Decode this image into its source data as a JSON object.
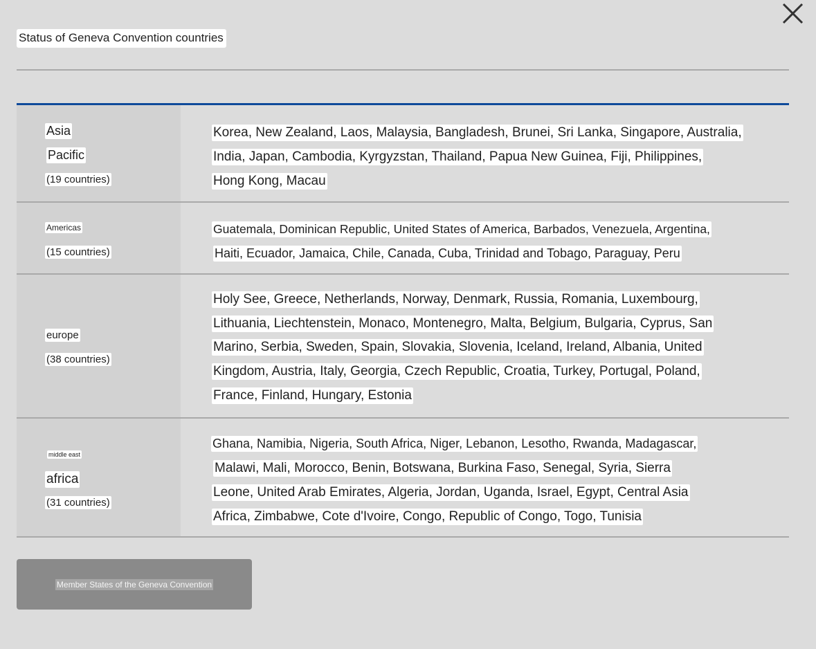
{
  "title": "Status of Geneva Convention countries",
  "close_icon": "close-icon",
  "colors": {
    "accent_rule": "#0e4a9a",
    "button": "#8a8a8a",
    "background": "#dcdcdc"
  },
  "rows": [
    {
      "region_lines": [
        "Asia",
        "Pacific"
      ],
      "count": "(19 countries)",
      "country_lines": [
        "Korea, New Zealand, Laos, Malaysia, Bangladesh, Brunei, Sri Lanka, Singapore, Australia,",
        "India, Japan, Cambodia, Kyrgyzstan, Thailand, Papua New Guinea, Fiji, Philippines,",
        "Hong Kong, Macau"
      ]
    },
    {
      "region_lines": [
        "Americas"
      ],
      "count": "(15 countries)",
      "country_lines": [
        "Guatemala, Dominican Republic, United States of America, Barbados, Venezuela, Argentina,",
        "Haiti, Ecuador, Jamaica, Chile, Canada, Cuba, Trinidad and Tobago, Paraguay, Peru"
      ]
    },
    {
      "region_lines": [
        "europe"
      ],
      "count": "(38 countries)",
      "country_lines": [
        "Holy See, Greece, Netherlands, Norway, Denmark, Russia, Romania, Luxembourg,",
        "Lithuania, Liechtenstein, Monaco, Montenegro, Malta, Belgium, Bulgaria, Cyprus, San",
        "Marino, Serbia, Sweden, Spain, Slovakia, Slovenia, Iceland, Ireland, Albania, United",
        "Kingdom, Austria, Italy, Georgia, Czech Republic, Croatia, Turkey, Portugal, Poland,",
        "France, Finland, Hungary, Estonia"
      ]
    },
    {
      "region_lines": [
        "middle east",
        "africa"
      ],
      "count": "(31 countries)",
      "country_lines": [
        "Ghana, Namibia, Nigeria, South Africa, Niger, Lebanon, Lesotho, Rwanda, Madagascar,",
        "Malawi, Mali, Morocco, Benin, Botswana, Burkina Faso, Senegal, Syria, Sierra",
        "Leone, United Arab Emirates, Algeria, Jordan, Uganda, Israel, Egypt, Central Asia",
        "Africa, Zimbabwe, Cote d'Ivoire, Congo, Republic of Congo, Togo, Tunisia"
      ]
    }
  ],
  "member_button_label": "Member States of the Geneva Convention"
}
